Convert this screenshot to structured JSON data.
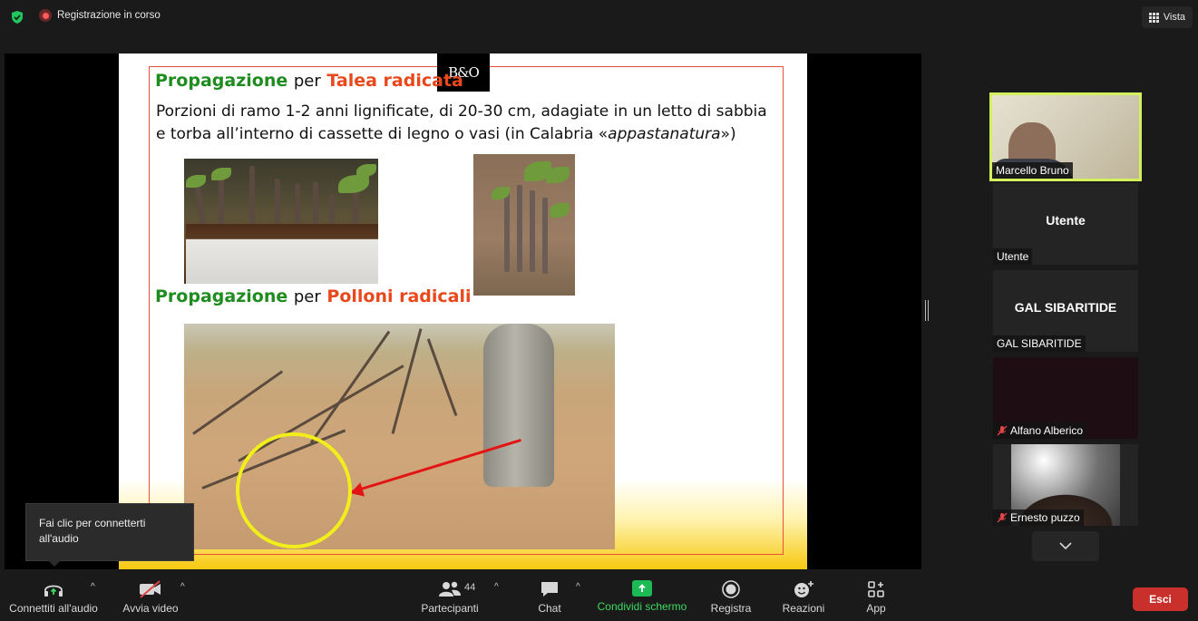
{
  "topbar": {
    "recording_label": "Registrazione in corso",
    "view_label": "Vista"
  },
  "slide": {
    "logo_text": "B&O",
    "section1": {
      "word_green": "Propagazione",
      "word_mid": "per",
      "word_red": "Talea radicata"
    },
    "body_line1": "Porzioni di ramo 1-2 anni lignificate, di 20-30 cm,  adagiate in un letto di sabbia",
    "body_line2_start": "e  torba all’interno di cassette di legno o vasi (in Calabria «",
    "body_line2_italic": "appastanatura",
    "body_line2_end": "»)",
    "section2": {
      "word_green": "Propagazione",
      "word_mid": "per",
      "word_red": "Polloni radicali"
    }
  },
  "gallery": {
    "tiles": [
      {
        "name": "Marcello Bruno",
        "muted": false,
        "video": true
      },
      {
        "name": "Utente",
        "center": "Utente",
        "muted": false,
        "video": false
      },
      {
        "name": "GAL SIBARITIDE",
        "center": "GAL SIBARITIDE",
        "muted": false,
        "video": false
      },
      {
        "name": "Alfano Alberico",
        "muted": true,
        "video": false
      },
      {
        "name": "Ernesto puzzo",
        "muted": true,
        "video": true
      }
    ]
  },
  "tooltip": {
    "line1": "Fai clic per connetterti",
    "line2": "all'audio"
  },
  "toolbar": {
    "audio_label": "Connettiti all'audio",
    "video_label": "Avvia video",
    "participants_label": "Partecipanti",
    "participants_count": "44",
    "chat_label": "Chat",
    "share_label": "Condividi schermo",
    "record_label": "Registra",
    "reactions_label": "Reazioni",
    "apps_label": "App",
    "leave_label": "Esci"
  },
  "colors": {
    "accent_green": "#3ddc62",
    "speaker_border": "#d4f05a",
    "leave_red": "#c9302c"
  }
}
